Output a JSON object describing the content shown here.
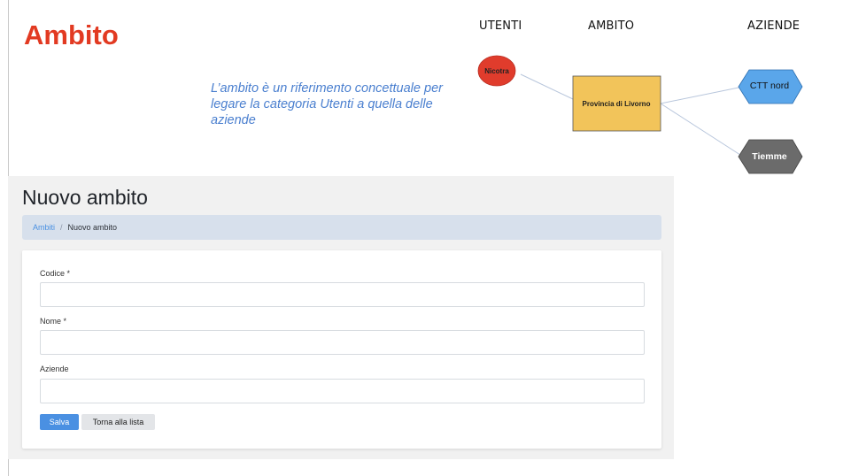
{
  "slide": {
    "title": "Ambito",
    "description": "L’ambito è un riferimento concettuale per legare la categoria Utenti a quella delle aziende",
    "columns": {
      "utenti": "UTENTI",
      "ambito": "AMBITO",
      "aziende": "AZIENDE"
    },
    "nodes": {
      "user": "Nicotra",
      "scope": "Provincia di Livorno",
      "companies": [
        "CTT nord",
        "Tiemme"
      ]
    },
    "colors": {
      "title": "#e23a22",
      "user_node": "#e03c2c",
      "scope_node": "#f2c45a",
      "company_1": "#5aa6ea",
      "company_2": "#6b6b6b",
      "description": "#4a7fcf"
    }
  },
  "app": {
    "page_title": "Nuovo ambito",
    "breadcrumb": {
      "parent": "Ambiti",
      "separator": "/",
      "current": "Nuovo ambito"
    },
    "form": {
      "fields": [
        {
          "label": "Codice *",
          "value": ""
        },
        {
          "label": "Nome *",
          "value": ""
        },
        {
          "label": "Aziende",
          "value": ""
        }
      ],
      "save_label": "Salva",
      "back_label": "Torna alla lista"
    },
    "colors": {
      "primary": "#4a90e2",
      "breadcrumb_bg": "#d7e0ec",
      "panel_bg": "#f1f1f1"
    }
  }
}
